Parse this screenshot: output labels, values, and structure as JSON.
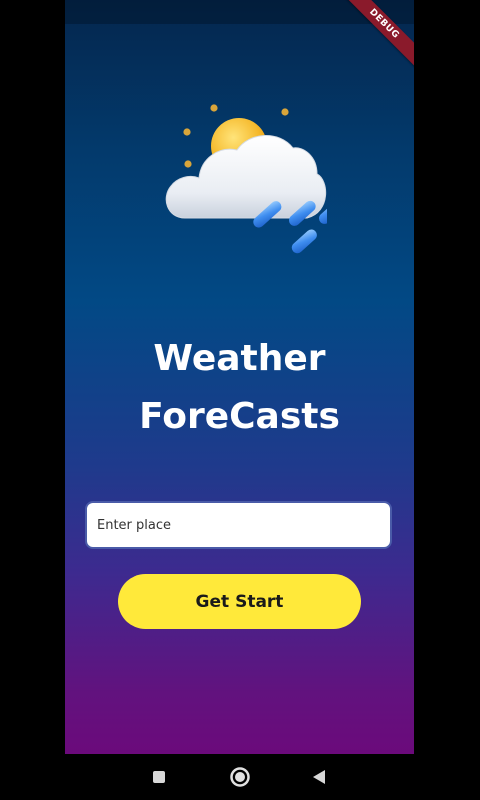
{
  "app": {
    "debug_banner": "DEBUG",
    "weather_icon": "sun-cloud-rain-icon",
    "title_line1": "Weather",
    "title_line2": "ForeCasts",
    "place_input": {
      "placeholder": "Enter place",
      "value": ""
    },
    "start_button_label": "Get Start"
  },
  "nav": {
    "recents_icon": "square-icon",
    "home_icon": "circle-icon",
    "back_icon": "triangle-back-icon"
  },
  "colors": {
    "gradient_top": "#04264d",
    "gradient_mid": "#024985",
    "gradient_bottom": "#6b0a7b",
    "button": "#ffe93a",
    "input_border": "#4a5ba8",
    "debug_banner": "#8a1a2b"
  }
}
